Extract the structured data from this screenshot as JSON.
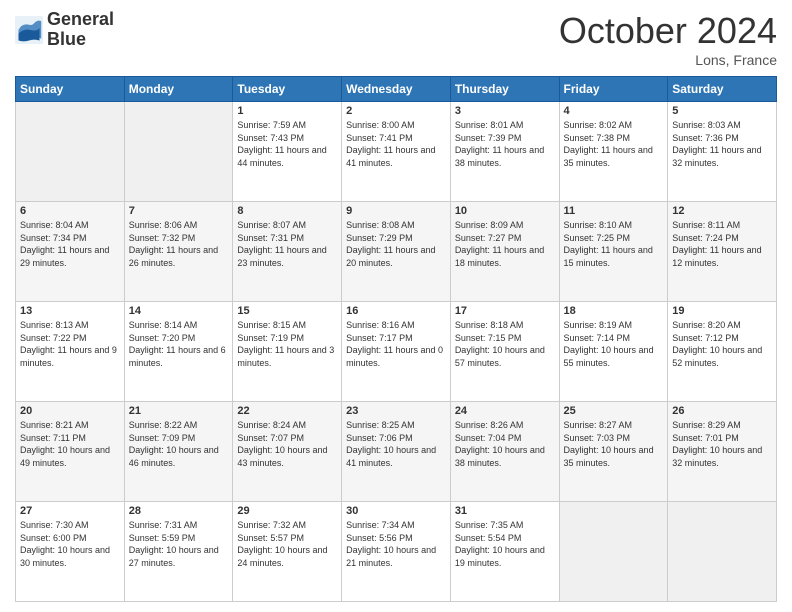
{
  "header": {
    "logo_line1": "General",
    "logo_line2": "Blue",
    "month": "October 2024",
    "location": "Lons, France"
  },
  "days_of_week": [
    "Sunday",
    "Monday",
    "Tuesday",
    "Wednesday",
    "Thursday",
    "Friday",
    "Saturday"
  ],
  "weeks": [
    [
      {
        "day": "",
        "sunrise": "",
        "sunset": "",
        "daylight": ""
      },
      {
        "day": "",
        "sunrise": "",
        "sunset": "",
        "daylight": ""
      },
      {
        "day": "1",
        "sunrise": "Sunrise: 7:59 AM",
        "sunset": "Sunset: 7:43 PM",
        "daylight": "Daylight: 11 hours and 44 minutes."
      },
      {
        "day": "2",
        "sunrise": "Sunrise: 8:00 AM",
        "sunset": "Sunset: 7:41 PM",
        "daylight": "Daylight: 11 hours and 41 minutes."
      },
      {
        "day": "3",
        "sunrise": "Sunrise: 8:01 AM",
        "sunset": "Sunset: 7:39 PM",
        "daylight": "Daylight: 11 hours and 38 minutes."
      },
      {
        "day": "4",
        "sunrise": "Sunrise: 8:02 AM",
        "sunset": "Sunset: 7:38 PM",
        "daylight": "Daylight: 11 hours and 35 minutes."
      },
      {
        "day": "5",
        "sunrise": "Sunrise: 8:03 AM",
        "sunset": "Sunset: 7:36 PM",
        "daylight": "Daylight: 11 hours and 32 minutes."
      }
    ],
    [
      {
        "day": "6",
        "sunrise": "Sunrise: 8:04 AM",
        "sunset": "Sunset: 7:34 PM",
        "daylight": "Daylight: 11 hours and 29 minutes."
      },
      {
        "day": "7",
        "sunrise": "Sunrise: 8:06 AM",
        "sunset": "Sunset: 7:32 PM",
        "daylight": "Daylight: 11 hours and 26 minutes."
      },
      {
        "day": "8",
        "sunrise": "Sunrise: 8:07 AM",
        "sunset": "Sunset: 7:31 PM",
        "daylight": "Daylight: 11 hours and 23 minutes."
      },
      {
        "day": "9",
        "sunrise": "Sunrise: 8:08 AM",
        "sunset": "Sunset: 7:29 PM",
        "daylight": "Daylight: 11 hours and 20 minutes."
      },
      {
        "day": "10",
        "sunrise": "Sunrise: 8:09 AM",
        "sunset": "Sunset: 7:27 PM",
        "daylight": "Daylight: 11 hours and 18 minutes."
      },
      {
        "day": "11",
        "sunrise": "Sunrise: 8:10 AM",
        "sunset": "Sunset: 7:25 PM",
        "daylight": "Daylight: 11 hours and 15 minutes."
      },
      {
        "day": "12",
        "sunrise": "Sunrise: 8:11 AM",
        "sunset": "Sunset: 7:24 PM",
        "daylight": "Daylight: 11 hours and 12 minutes."
      }
    ],
    [
      {
        "day": "13",
        "sunrise": "Sunrise: 8:13 AM",
        "sunset": "Sunset: 7:22 PM",
        "daylight": "Daylight: 11 hours and 9 minutes."
      },
      {
        "day": "14",
        "sunrise": "Sunrise: 8:14 AM",
        "sunset": "Sunset: 7:20 PM",
        "daylight": "Daylight: 11 hours and 6 minutes."
      },
      {
        "day": "15",
        "sunrise": "Sunrise: 8:15 AM",
        "sunset": "Sunset: 7:19 PM",
        "daylight": "Daylight: 11 hours and 3 minutes."
      },
      {
        "day": "16",
        "sunrise": "Sunrise: 8:16 AM",
        "sunset": "Sunset: 7:17 PM",
        "daylight": "Daylight: 11 hours and 0 minutes."
      },
      {
        "day": "17",
        "sunrise": "Sunrise: 8:18 AM",
        "sunset": "Sunset: 7:15 PM",
        "daylight": "Daylight: 10 hours and 57 minutes."
      },
      {
        "day": "18",
        "sunrise": "Sunrise: 8:19 AM",
        "sunset": "Sunset: 7:14 PM",
        "daylight": "Daylight: 10 hours and 55 minutes."
      },
      {
        "day": "19",
        "sunrise": "Sunrise: 8:20 AM",
        "sunset": "Sunset: 7:12 PM",
        "daylight": "Daylight: 10 hours and 52 minutes."
      }
    ],
    [
      {
        "day": "20",
        "sunrise": "Sunrise: 8:21 AM",
        "sunset": "Sunset: 7:11 PM",
        "daylight": "Daylight: 10 hours and 49 minutes."
      },
      {
        "day": "21",
        "sunrise": "Sunrise: 8:22 AM",
        "sunset": "Sunset: 7:09 PM",
        "daylight": "Daylight: 10 hours and 46 minutes."
      },
      {
        "day": "22",
        "sunrise": "Sunrise: 8:24 AM",
        "sunset": "Sunset: 7:07 PM",
        "daylight": "Daylight: 10 hours and 43 minutes."
      },
      {
        "day": "23",
        "sunrise": "Sunrise: 8:25 AM",
        "sunset": "Sunset: 7:06 PM",
        "daylight": "Daylight: 10 hours and 41 minutes."
      },
      {
        "day": "24",
        "sunrise": "Sunrise: 8:26 AM",
        "sunset": "Sunset: 7:04 PM",
        "daylight": "Daylight: 10 hours and 38 minutes."
      },
      {
        "day": "25",
        "sunrise": "Sunrise: 8:27 AM",
        "sunset": "Sunset: 7:03 PM",
        "daylight": "Daylight: 10 hours and 35 minutes."
      },
      {
        "day": "26",
        "sunrise": "Sunrise: 8:29 AM",
        "sunset": "Sunset: 7:01 PM",
        "daylight": "Daylight: 10 hours and 32 minutes."
      }
    ],
    [
      {
        "day": "27",
        "sunrise": "Sunrise: 7:30 AM",
        "sunset": "Sunset: 6:00 PM",
        "daylight": "Daylight: 10 hours and 30 minutes."
      },
      {
        "day": "28",
        "sunrise": "Sunrise: 7:31 AM",
        "sunset": "Sunset: 5:59 PM",
        "daylight": "Daylight: 10 hours and 27 minutes."
      },
      {
        "day": "29",
        "sunrise": "Sunrise: 7:32 AM",
        "sunset": "Sunset: 5:57 PM",
        "daylight": "Daylight: 10 hours and 24 minutes."
      },
      {
        "day": "30",
        "sunrise": "Sunrise: 7:34 AM",
        "sunset": "Sunset: 5:56 PM",
        "daylight": "Daylight: 10 hours and 21 minutes."
      },
      {
        "day": "31",
        "sunrise": "Sunrise: 7:35 AM",
        "sunset": "Sunset: 5:54 PM",
        "daylight": "Daylight: 10 hours and 19 minutes."
      },
      {
        "day": "",
        "sunrise": "",
        "sunset": "",
        "daylight": ""
      },
      {
        "day": "",
        "sunrise": "",
        "sunset": "",
        "daylight": ""
      }
    ]
  ]
}
